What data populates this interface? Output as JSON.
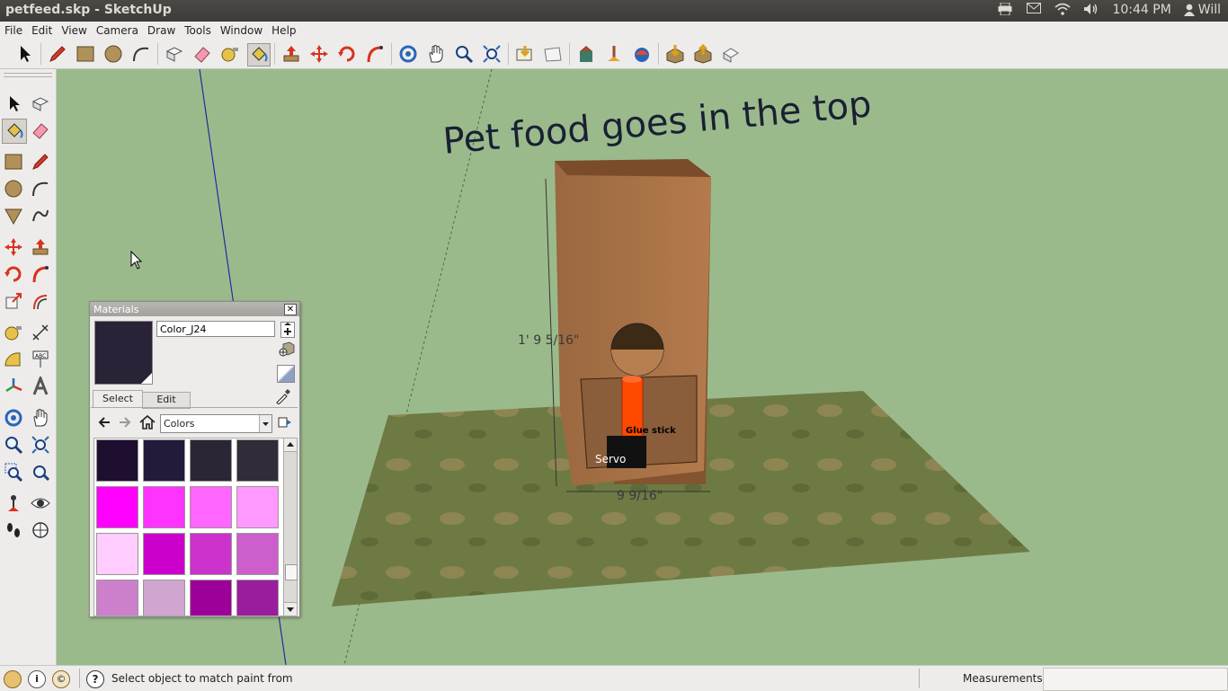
{
  "window": {
    "title": "petfeed.skp - SketchUp"
  },
  "system_tray": {
    "icons": [
      "printer-icon",
      "mail-icon",
      "wifi-icon",
      "volume-icon"
    ],
    "time": "10:44 PM",
    "user": "Will"
  },
  "menu": {
    "items": [
      {
        "label": "File"
      },
      {
        "label": "Edit"
      },
      {
        "label": "View"
      },
      {
        "label": "Camera"
      },
      {
        "label": "Draw"
      },
      {
        "label": "Tools"
      },
      {
        "label": "Window"
      },
      {
        "label": "Help"
      }
    ]
  },
  "toolbar": {
    "tools": [
      "select",
      "pencil",
      "rectangle",
      "circle",
      "arc",
      "make-component",
      "eraser",
      "tape-measure",
      "paint-bucket",
      "push-pull",
      "move",
      "rotate",
      "follow-me",
      "orbit",
      "pan",
      "zoom",
      "zoom-extents",
      "previous-view",
      "next-view",
      "walk",
      "position-camera",
      "look-around",
      "get-models",
      "share-model",
      "share-component",
      "cube-view"
    ]
  },
  "viewport": {
    "annotation_text": "Pet food goes in the top",
    "dimension_height": "1' 9 5/16\"",
    "dimension_width": "9 9/16\"",
    "label_glue_stick": "Glue stick",
    "label_servo": "Servo"
  },
  "materials_panel": {
    "title": "Materials",
    "material_name": "Color_J24",
    "preview_color": "#2a2236",
    "tabs": [
      {
        "label": "Select"
      },
      {
        "label": "Edit"
      }
    ],
    "library_select": "Colors",
    "swatches": [
      "#1e0e30",
      "#241a3a",
      "#2a2636",
      "#302c38",
      "#ff00ff",
      "#ff33ff",
      "#ff66ff",
      "#ff99ff",
      "#ffccff",
      "#cc00cc",
      "#cc33cc",
      "#cc5fcc",
      "#cc80cc",
      "#d0a6d0",
      "#9c0099",
      "#9a1d9c"
    ]
  },
  "status": {
    "message": "Select object to match paint from",
    "measurements_label": "Measurements",
    "measurements_value": ""
  },
  "colors": {
    "sky_ground": "#9bba8c",
    "box_wood": "#a66d42",
    "tube": "#ff4800"
  }
}
